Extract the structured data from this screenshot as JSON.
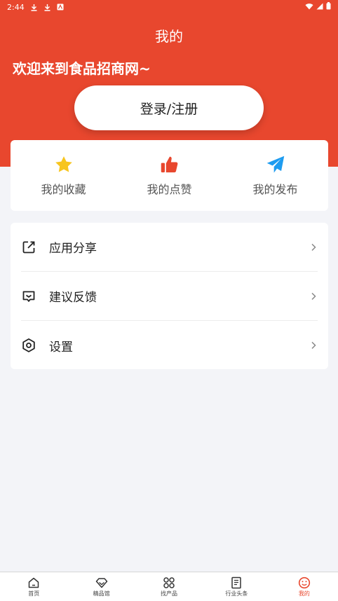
{
  "status_bar": {
    "time": "2:44"
  },
  "header": {
    "title": "我的",
    "welcome": "欢迎来到食品招商网~",
    "login_label": "登录/注册"
  },
  "quick_actions": [
    {
      "label": "我的收藏",
      "icon": "star-icon"
    },
    {
      "label": "我的点赞",
      "icon": "thumbs-up-icon"
    },
    {
      "label": "我的发布",
      "icon": "paper-plane-icon"
    }
  ],
  "menu": [
    {
      "label": "应用分享",
      "icon": "share-icon"
    },
    {
      "label": "建议反馈",
      "icon": "feedback-icon"
    },
    {
      "label": "设置",
      "icon": "settings-icon"
    }
  ],
  "tabbar": [
    {
      "label": "首页",
      "icon": "home-icon"
    },
    {
      "label": "精品馆",
      "icon": "diamond-icon"
    },
    {
      "label": "找产品",
      "icon": "grid-icon"
    },
    {
      "label": "行业头条",
      "icon": "news-icon"
    },
    {
      "label": "我的",
      "icon": "profile-icon",
      "active": true
    }
  ],
  "colors": {
    "brand": "#e8472e",
    "star": "#f7c51e",
    "thumb": "#e8472e",
    "plane": "#1e9cf0",
    "background": "#f3f4f8"
  }
}
